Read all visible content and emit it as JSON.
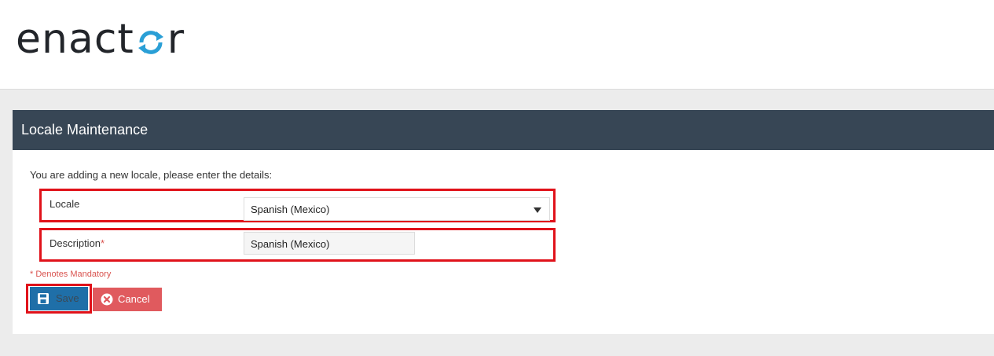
{
  "brand": {
    "logo_text_start": "enact",
    "logo_text_end": "r",
    "accent": "#2a9fd6"
  },
  "panel": {
    "title": "Locale Maintenance",
    "intro": "You are adding a new locale, please enter the details:"
  },
  "form": {
    "locale_label": "Locale",
    "locale_value": "Spanish (Mexico)",
    "description_label": "Description",
    "description_required_mark": "*",
    "description_value": "Spanish (Mexico)",
    "mandatory_note": "* Denotes Mandatory"
  },
  "actions": {
    "save_label": "Save",
    "cancel_label": "Cancel"
  },
  "colors": {
    "header_bar": "#374655",
    "save_button": "#1f6fa8",
    "cancel_button": "#e05a5e",
    "highlight_border": "#e0121a",
    "required": "#d9534f"
  },
  "icons": {
    "logo_o": "refresh-cycle-icon",
    "save": "floppy-disk-icon",
    "cancel": "circle-x-icon",
    "dropdown": "caret-down-icon"
  }
}
